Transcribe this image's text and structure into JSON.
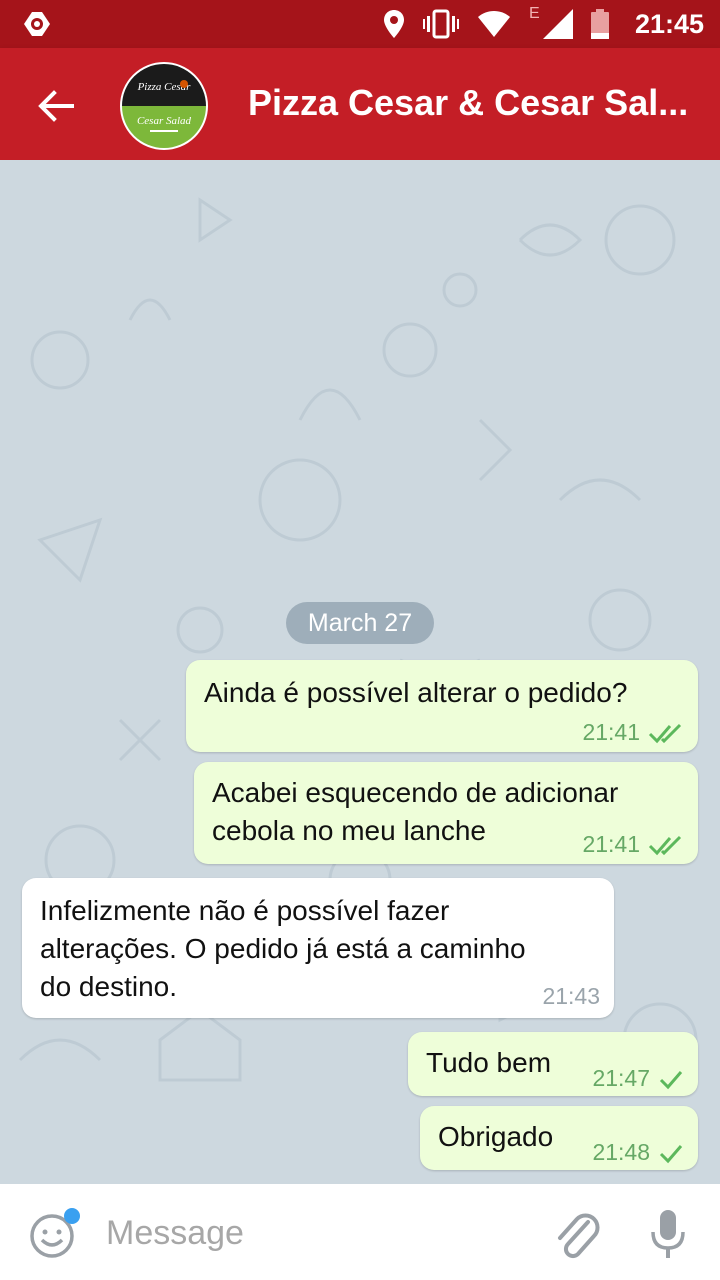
{
  "status_bar": {
    "time": "21:45",
    "network_letter": "E",
    "icons": [
      "app-notification-icon",
      "location-icon",
      "vibrate-icon",
      "wifi-icon",
      "signal-icon",
      "battery-icon"
    ]
  },
  "header": {
    "title": "Pizza Cesar & Cesar Sal...",
    "back_icon": "arrow-left-icon",
    "avatar_text_top": "Pizza Cesar",
    "avatar_text_bottom": "Cesar Salad"
  },
  "chat": {
    "date_label": "March 27",
    "messages": [
      {
        "direction": "out",
        "text": "Ainda é possível alterar o pedido?",
        "time": "21:41",
        "status": "read"
      },
      {
        "direction": "out",
        "line1": "Acabei esquecendo de adicionar",
        "line2": "cebola no meu lanche",
        "time": "21:41",
        "status": "read"
      },
      {
        "direction": "in",
        "line1": "Infelizmente não é possível fazer",
        "line2": "alterações. O pedido já está a caminho",
        "line3": "do destino.",
        "time": "21:43"
      },
      {
        "direction": "out",
        "text": "Tudo bem",
        "time": "21:47",
        "status": "sent"
      },
      {
        "direction": "out",
        "text": "Obrigado",
        "time": "21:48",
        "status": "sent"
      }
    ]
  },
  "composer": {
    "placeholder": "Message",
    "emoji_icon": "emoji-icon",
    "attach_icon": "paperclip-icon",
    "mic_icon": "microphone-icon"
  },
  "colors": {
    "status_bar": "#a5141a",
    "app_bar": "#c41e26",
    "outgoing_bubble": "#eefed9",
    "incoming_bubble": "#ffffff",
    "chat_background": "#cdd8df",
    "check_green": "#5cb85c"
  }
}
